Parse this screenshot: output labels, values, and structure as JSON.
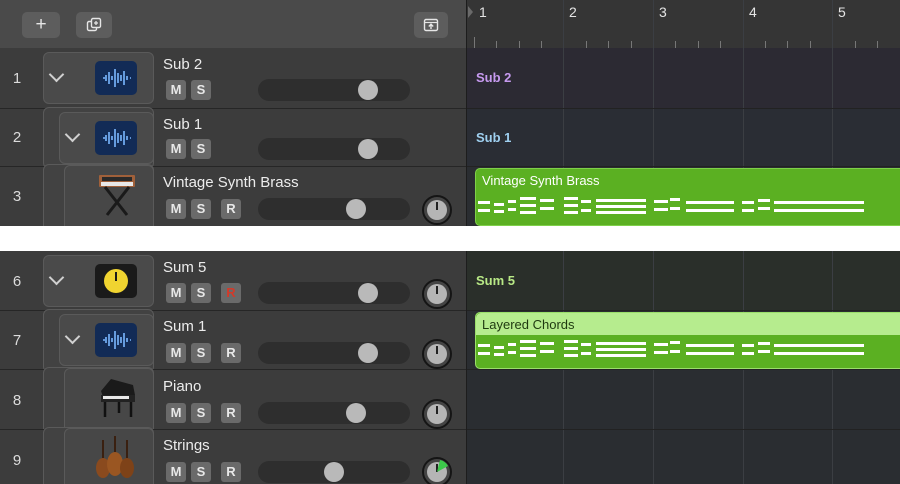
{
  "toolbar": {
    "add_label": "+"
  },
  "ruler": {
    "bars": [
      "1",
      "2",
      "3",
      "4",
      "5"
    ]
  },
  "tracks": [
    {
      "num": "1",
      "name": "Sub 2",
      "icon": "waveform-icon"
    },
    {
      "num": "2",
      "name": "Sub 1",
      "icon": "waveform-icon"
    },
    {
      "num": "3",
      "name": "Vintage Synth Brass",
      "icon": "synthesizer-icon"
    },
    {
      "num": "6",
      "name": "Sum 5",
      "icon": "summing-stack-icon"
    },
    {
      "num": "7",
      "name": "Sum 1",
      "icon": "waveform-icon"
    },
    {
      "num": "8",
      "name": "Piano",
      "icon": "grand-piano-icon"
    },
    {
      "num": "9",
      "name": "Strings",
      "icon": "strings-icon"
    }
  ],
  "buttons": {
    "mute": "M",
    "solo": "S",
    "record": "R"
  },
  "volume_levels": [
    0.74,
    0.74,
    0.66,
    0.74,
    0.74,
    0.66,
    0.51
  ],
  "lanes": {
    "sub2_label": "Sub 2",
    "sub1_label": "Sub 1",
    "sum5_label": "Sum 5",
    "region_vintage": "Vintage Synth Brass",
    "region_layered": "Layered Chords"
  },
  "colors": {
    "accent_purple": "#c79af0",
    "accent_blue": "#9fd0f0",
    "accent_green": "#b8e986",
    "region_green": "#5bb022",
    "region_light_green": "#b6ec8e",
    "record_red": "#d23a2a",
    "summing_yellow": "#f0d430"
  }
}
